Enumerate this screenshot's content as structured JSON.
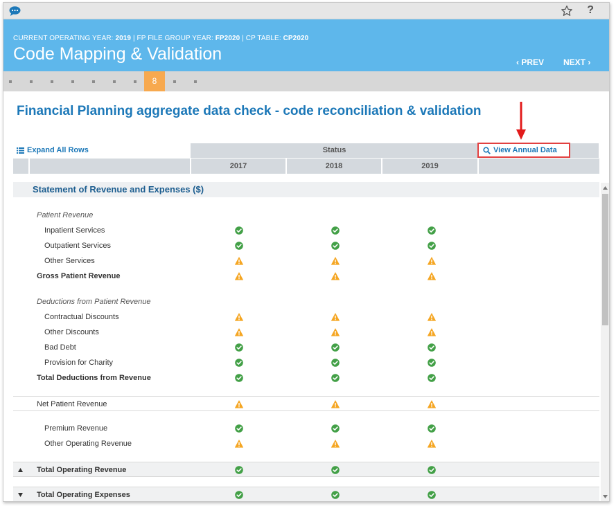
{
  "context": {
    "operating_year_label": "CURRENT OPERATING YEAR: ",
    "operating_year": "2019",
    "fp_label": " | FP FILE GROUP YEAR: ",
    "fp_value": "FP2020",
    "cp_label": " | CP TABLE: ",
    "cp_value": "CP2020"
  },
  "page_title": "Code Mapping & Validation",
  "nav": {
    "prev": "‹ PREV",
    "next": "NEXT ›"
  },
  "stepper": {
    "current_step": "8"
  },
  "section_heading": "Financial Planning aggregate data check - code reconciliation & validation",
  "toolbar": {
    "expand_all": "Expand All Rows",
    "view_annual": "View Annual Data"
  },
  "table": {
    "status_header": "Status",
    "years": [
      "2017",
      "2018",
      "2019"
    ],
    "group_title": "Statement of Revenue and Expenses ($)",
    "rows": [
      {
        "label": "Patient Revenue",
        "style": "italic",
        "status": []
      },
      {
        "label": "Inpatient Services",
        "style": "indent",
        "status": [
          "ok",
          "ok",
          "ok"
        ]
      },
      {
        "label": "Outpatient Services",
        "style": "indent",
        "status": [
          "ok",
          "ok",
          "ok"
        ]
      },
      {
        "label": "Other Services",
        "style": "indent",
        "status": [
          "warn",
          "warn",
          "warn"
        ]
      },
      {
        "label": "Gross Patient Revenue",
        "style": "bold",
        "status": [
          "warn",
          "warn",
          "warn"
        ]
      },
      {
        "label": "Deductions from Patient Revenue",
        "style": "italic",
        "status": []
      },
      {
        "label": "Contractual Discounts",
        "style": "indent",
        "status": [
          "warn",
          "warn",
          "warn"
        ]
      },
      {
        "label": "Other Discounts",
        "style": "indent",
        "status": [
          "warn",
          "warn",
          "warn"
        ]
      },
      {
        "label": "Bad Debt",
        "style": "indent",
        "status": [
          "ok",
          "ok",
          "ok"
        ]
      },
      {
        "label": "Provision for Charity",
        "style": "indent",
        "status": [
          "ok",
          "ok",
          "ok"
        ]
      },
      {
        "label": "Total Deductions from Revenue",
        "style": "bold",
        "status": [
          "ok",
          "ok",
          "ok"
        ]
      },
      {
        "label": "Net Patient Revenue",
        "style": "separator",
        "status": [
          "warn",
          "warn",
          "warn"
        ]
      },
      {
        "label": "Premium Revenue",
        "style": "indent",
        "status": [
          "ok",
          "ok",
          "ok"
        ]
      },
      {
        "label": "Other Operating Revenue",
        "style": "indent",
        "status": [
          "warn",
          "warn",
          "warn"
        ]
      },
      {
        "label": "Total Operating Revenue",
        "style": "total-collapse",
        "status": [
          "ok",
          "ok",
          "ok"
        ]
      },
      {
        "label": "Total Operating Expenses",
        "style": "total-expand",
        "status": [
          "ok",
          "ok",
          "ok"
        ]
      }
    ]
  },
  "colors": {
    "ok": "#43a047",
    "warn": "#f5a623",
    "accent": "#1c78b8",
    "header_bg": "#5eb7eb",
    "step_active": "#f7a94f",
    "highlight_border": "#e24040"
  }
}
